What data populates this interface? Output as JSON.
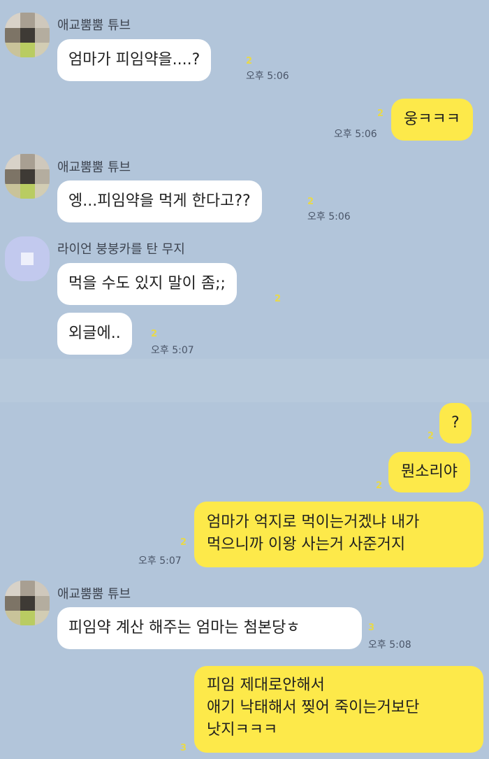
{
  "chat": {
    "senders": {
      "tube": "애교뿜뿜 튜브",
      "lion": "라이언 붕붕카를 탄 무지"
    },
    "colors": {
      "background": "#b2c5da",
      "incoming_bubble": "#ffffff",
      "outgoing_bubble": "#fde94a",
      "unread_count": "#e8d94a"
    },
    "messages": [
      {
        "text": "엄마가 피임약을....?",
        "read": "2",
        "time": "오후 5:06"
      },
      {
        "text": "웅ㅋㅋㅋ",
        "read": "2",
        "time": "오후 5:06"
      },
      {
        "text": "엥...피임약을 먹게 한다고??",
        "read": "2",
        "time": "오후 5:06"
      },
      {
        "text": "먹을 수도 있지 말이 좀;;",
        "read": "2"
      },
      {
        "text": "외글에..",
        "read": "2",
        "time": "오후 5:07"
      },
      {
        "text": "?",
        "read": "2"
      },
      {
        "text": "뭔소리야",
        "read": "2"
      },
      {
        "text": "엄마가 억지로 먹이는거겠냐 내가\n먹으니까 이왕 사는거 사준거지",
        "read": "2",
        "time": "오후 5:07"
      },
      {
        "text": "피임약 계산 해주는 엄마는 첨본당ㅎ",
        "read": "3",
        "time": "오후 5:08"
      },
      {
        "text": "피임 제대로안해서\n애기 낙태해서 찢어 죽이는거보단\n낫지ㅋㅋㅋ",
        "read": "3"
      }
    ]
  }
}
